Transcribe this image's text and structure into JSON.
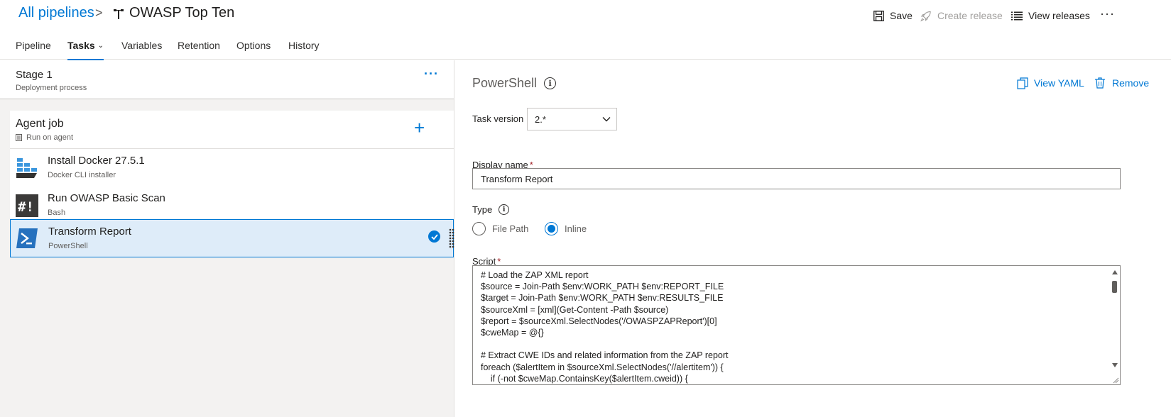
{
  "header": {
    "breadcrumb_link": "All pipelines",
    "breadcrumb_separator": ">",
    "pipeline_name": "OWASP Top Ten",
    "save_label": "Save",
    "create_release_label": "Create release",
    "view_releases_label": "View releases",
    "more_label": "···"
  },
  "tabs": [
    {
      "label": "Pipeline"
    },
    {
      "label": "Tasks",
      "active": true
    },
    {
      "label": "Variables"
    },
    {
      "label": "Retention"
    },
    {
      "label": "Options"
    },
    {
      "label": "History"
    }
  ],
  "stage": {
    "title": "Stage 1",
    "subtitle": "Deployment process",
    "more_label": "···"
  },
  "agent_job": {
    "title": "Agent job",
    "subtitle": "Run on agent",
    "add_label": "+"
  },
  "tasks": [
    {
      "title": "Install Docker 27.5.1",
      "subtitle": "Docker CLI installer",
      "icon": "docker-installer-icon"
    },
    {
      "title": "Run OWASP Basic Scan",
      "subtitle": "Bash",
      "icon": "bash-icon"
    },
    {
      "title": "Transform Report",
      "subtitle": "PowerShell",
      "icon": "powershell-icon",
      "selected": true
    }
  ],
  "details": {
    "task_name": "PowerShell",
    "view_yaml_label": "View YAML",
    "remove_label": "Remove",
    "task_version_label": "Task version",
    "task_version_value": "2.*",
    "display_name_label": "Display name",
    "required_mark": "*",
    "display_name_value": "Transform Report",
    "type_label": "Type",
    "type_options": [
      {
        "label": "File Path",
        "checked": false
      },
      {
        "label": "Inline",
        "checked": true
      }
    ],
    "script_label": "Script",
    "script_lines": [
      "# Load the ZAP XML report",
      "$source = Join-Path $env:WORK_PATH $env:REPORT_FILE",
      "$target = Join-Path $env:WORK_PATH $env:RESULTS_FILE",
      "$sourceXml = [xml](Get-Content -Path $source)",
      "$report = $sourceXml.SelectNodes('/OWASPZAPReport')[0]",
      "$cweMap = @{}",
      "",
      "# Extract CWE IDs and related information from the ZAP report",
      "foreach ($alertItem in $sourceXml.SelectNodes('//alertitem')) {",
      "    if (-not $cweMap.ContainsKey($alertItem.cweid)) {"
    ]
  },
  "colors": {
    "accent": "#0078d4",
    "selected_bg": "#deecf9",
    "panel_bg": "#f3f2f1",
    "required": "#a4262c"
  }
}
